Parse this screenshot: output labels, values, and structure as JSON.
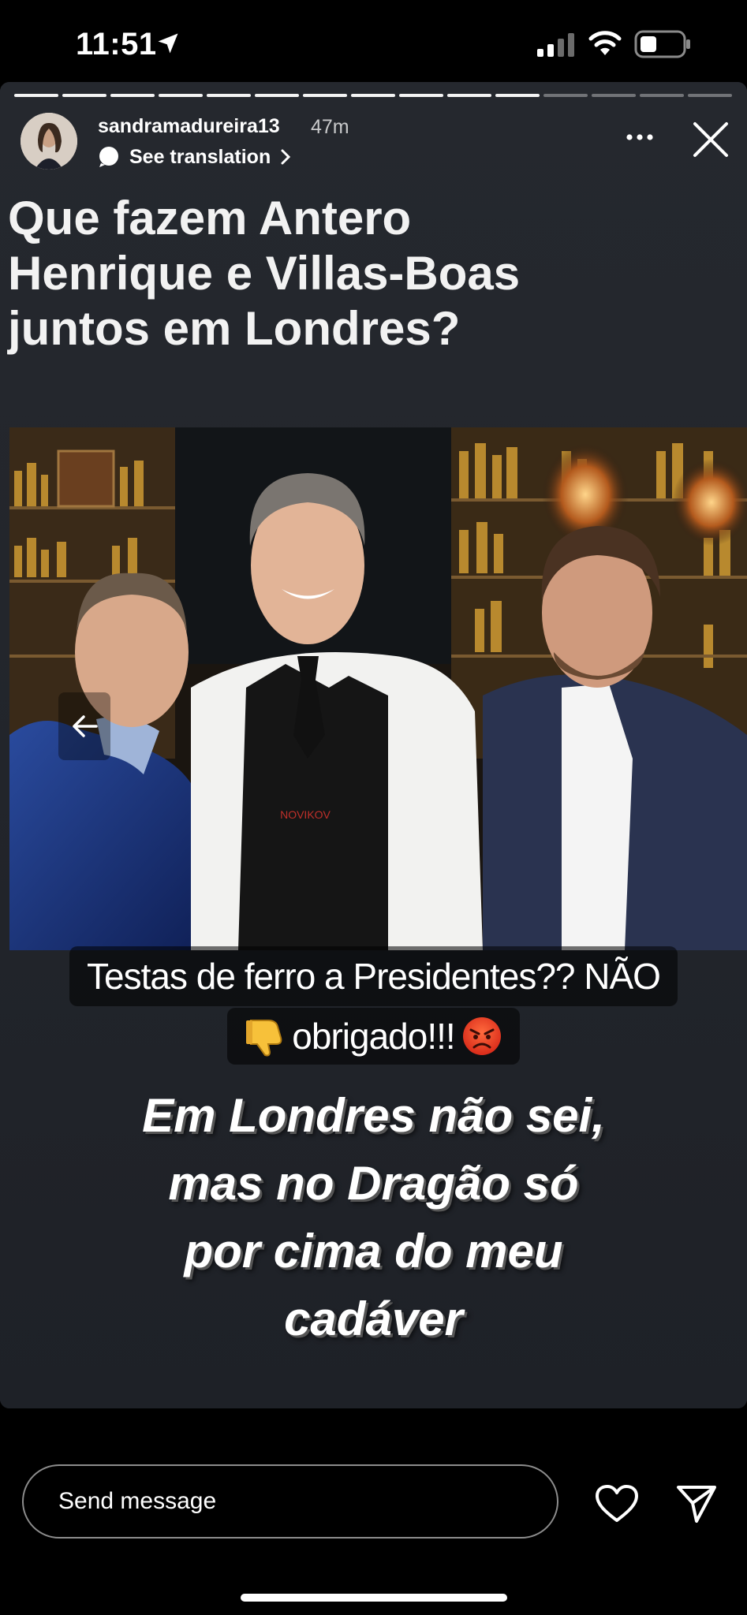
{
  "status_bar": {
    "time": "11:51",
    "icons": [
      "location-arrow-icon",
      "cellular-signal-icon",
      "wifi-icon",
      "battery-icon"
    ]
  },
  "story": {
    "progress": {
      "segments": 15,
      "completed": 11
    },
    "user": {
      "username": "sandramadureira13",
      "time_ago": "47m"
    },
    "see_translation": "See translation",
    "headline_lines": [
      "Que fazem Antero",
      "Henrique e Villas-Boas",
      "juntos em Londres?"
    ],
    "caption_line1": "Testas de ferro a Presidentes?? NÃO",
    "caption_line2": "obrigado!!!",
    "caption_emojis": [
      "thumbs-down-icon",
      "angry-face-icon"
    ],
    "statement_lines": [
      "Em Londres não sei,",
      "mas no Dragão só",
      "por cima do meu",
      "cadáver"
    ],
    "photo_apron_text": "NOVIKOV"
  },
  "reply": {
    "placeholder": "Send message"
  },
  "colors": {
    "story_bg": "#22252b",
    "screen_bg": "#000000",
    "text": "#ffffff"
  }
}
